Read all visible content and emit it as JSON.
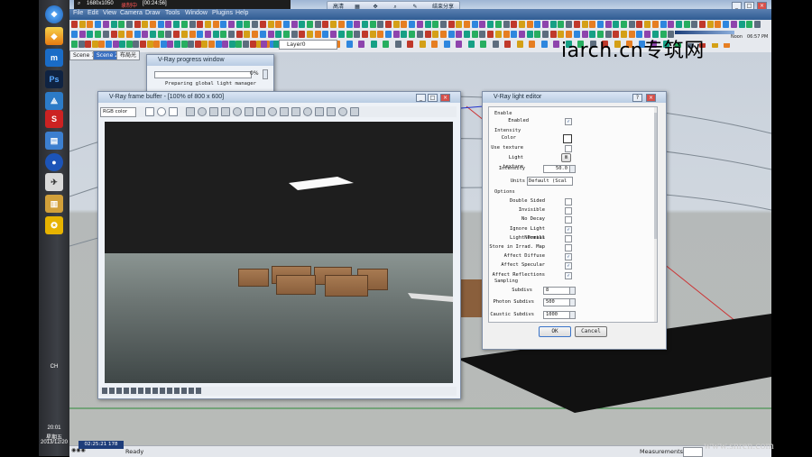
{
  "recorder": {
    "resolution": "1680x1050",
    "status": "录制中",
    "time": "[00:24:56]"
  },
  "controls": {
    "btn1": "高清",
    "btn2": "结束分享"
  },
  "menu": [
    "File",
    "Edit",
    "View",
    "Camera",
    "Draw",
    "Tools",
    "Window",
    "Plugins",
    "Help"
  ],
  "layer": "Layer0",
  "info": {
    "label1": "Noon",
    "label2": "06:57 PM"
  },
  "scenes": [
    "Scene 1",
    "Scene 2",
    "布局光"
  ],
  "watermark": "iarch.cn专筑网",
  "watermark2": "www.snren.com",
  "progress": {
    "title": "V-Ray progress window",
    "percent": "0%",
    "message": "Preparing global light manager"
  },
  "vfb": {
    "title": "V-Ray frame buffer - [100% of 800 x 600]",
    "channel": "RGB color"
  },
  "light_editor": {
    "title": "V-Ray light editor",
    "enable_section": "Enable",
    "enabled_label": "Enabled",
    "intensity_section": "Intensity",
    "color_label": "Color",
    "use_texture_label": "Use texture",
    "light_texture_label": "Light texture",
    "light_texture_btn": "m",
    "intensity_label": "Intensity",
    "intensity_value": "50.0",
    "units_label": "Units",
    "units_value": "Default (Scal",
    "options_section": "Options",
    "options": [
      {
        "label": "Double Sided",
        "checked": false
      },
      {
        "label": "Invisible",
        "checked": false
      },
      {
        "label": "No Decay",
        "checked": false
      },
      {
        "label": "Ignore Light Normals",
        "checked": true
      },
      {
        "label": "Light Portal",
        "checked": false
      },
      {
        "label": "Store in Irrad. Map",
        "checked": false
      },
      {
        "label": "Affect Diffuse",
        "checked": true
      },
      {
        "label": "Affect Specular",
        "checked": true
      },
      {
        "label": "Affect Reflections",
        "checked": true
      }
    ],
    "sampling_section": "Sampling",
    "subdivs_label": "Subdivs",
    "subdivs_value": "8",
    "photon_label": "Photon Subdivs",
    "photon_value": "500",
    "caustic_label": "Caustic Subdivs",
    "caustic_value": "1000",
    "ok": "OK",
    "cancel": "Cancel"
  },
  "statusbar": {
    "ready": "Ready",
    "measurements": "Measurements",
    "clock": "02:25:21",
    "speed": "178"
  },
  "taskbar": {
    "time": "20:01",
    "weekday": "星期五",
    "date": "2013/12/20",
    "lang": "CH"
  }
}
